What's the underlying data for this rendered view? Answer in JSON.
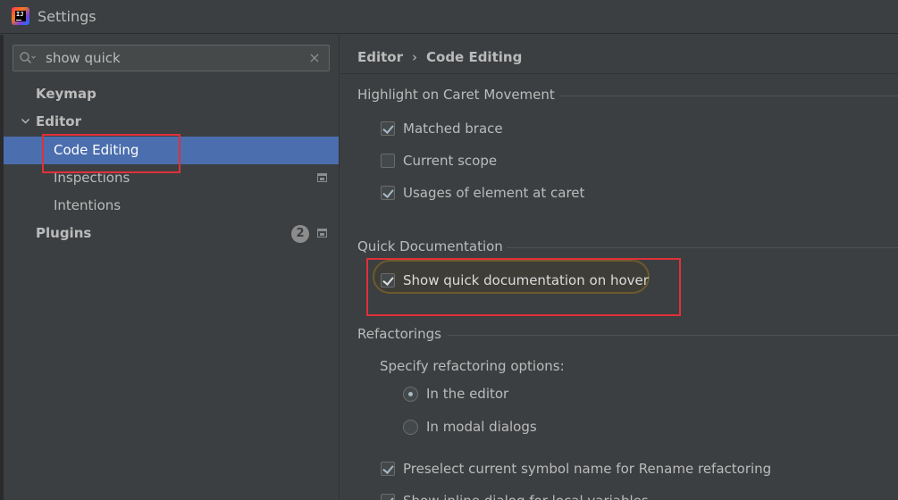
{
  "window": {
    "title": "Settings",
    "app_icon": "intellij-idea-icon"
  },
  "search": {
    "value": "show quick",
    "icon": "search-icon",
    "clear_icon": "clear-icon"
  },
  "sidebar": {
    "items": [
      {
        "label": "Keymap"
      },
      {
        "label": "Editor",
        "expanded": true
      },
      {
        "label": "Code Editing",
        "selected": true
      },
      {
        "label": "Inspections"
      },
      {
        "label": "Intentions"
      },
      {
        "label": "Plugins",
        "badge": "2"
      }
    ]
  },
  "breadcrumb": {
    "parent": "Editor",
    "separator": "›",
    "current": "Code Editing"
  },
  "sections": {
    "highlight": {
      "title": "Highlight on Caret Movement",
      "options": [
        {
          "label": "Matched brace",
          "checked": true
        },
        {
          "label": "Current scope",
          "checked": false
        },
        {
          "label": "Usages of element at caret",
          "checked": true
        }
      ]
    },
    "quickdoc": {
      "title": "Quick Documentation",
      "options": [
        {
          "label": "Show quick documentation on hover",
          "checked": true
        }
      ]
    },
    "refactorings": {
      "title": "Refactorings",
      "subtitle": "Specify refactoring options:",
      "radios": [
        {
          "label": "In the editor",
          "selected": true
        },
        {
          "label": "In modal dialogs",
          "selected": false
        }
      ],
      "options": [
        {
          "label": "Preselect current symbol name for Rename refactoring",
          "checked": true
        },
        {
          "label": "Show inline dialog for local variables",
          "checked": true
        }
      ]
    }
  },
  "colors": {
    "selection": "#4b6eaf",
    "highlight_box": "#e0303a",
    "background": "#3c3f41"
  }
}
